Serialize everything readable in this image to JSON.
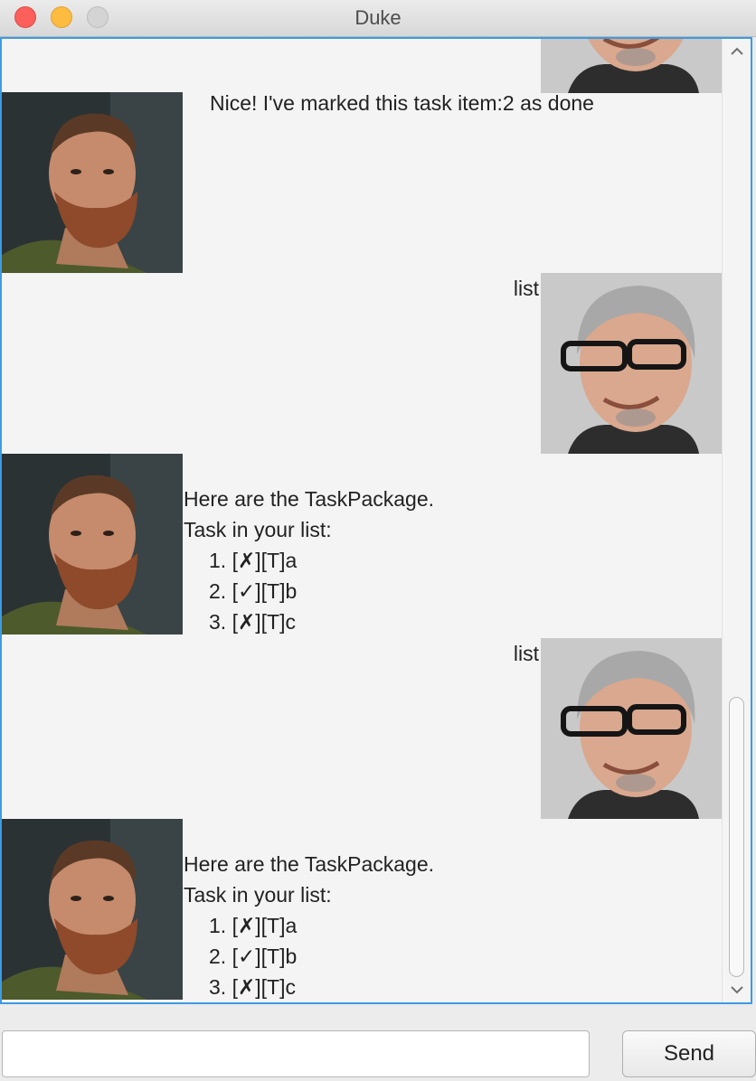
{
  "window": {
    "title": "Duke"
  },
  "dialog": {
    "duke_reply_1": "Nice! I've marked this task item:2 as done",
    "user_msg_1": "list",
    "duke_reply_2": {
      "line1": "Here are the TaskPackage.",
      "line2": "Task in your list:",
      "tasks": [
        {
          "num": "1.",
          "open": "[",
          "mark": "✗",
          "close": "][T]a"
        },
        {
          "num": "2.",
          "open": "[",
          "mark": "✓",
          "close": "][T]b"
        },
        {
          "num": "3.",
          "open": "[",
          "mark": "✗",
          "close": "][T]c"
        }
      ]
    },
    "user_msg_2": "list",
    "duke_reply_3": {
      "line1": "Here are the TaskPackage.",
      "line2": "Task in your list:",
      "tasks": [
        {
          "num": "1.",
          "open": "[",
          "mark": "✗",
          "close": "][T]a"
        },
        {
          "num": "2.",
          "open": "[",
          "mark": "✓",
          "close": "][T]b"
        },
        {
          "num": "3.",
          "open": "[",
          "mark": "✗",
          "close": "][T]c"
        }
      ]
    }
  },
  "input": {
    "value": "",
    "placeholder": ""
  },
  "send_label": "Send",
  "colors": {
    "focus_border": "#3c9be3",
    "dialog_bg": "#f4f4f4"
  }
}
